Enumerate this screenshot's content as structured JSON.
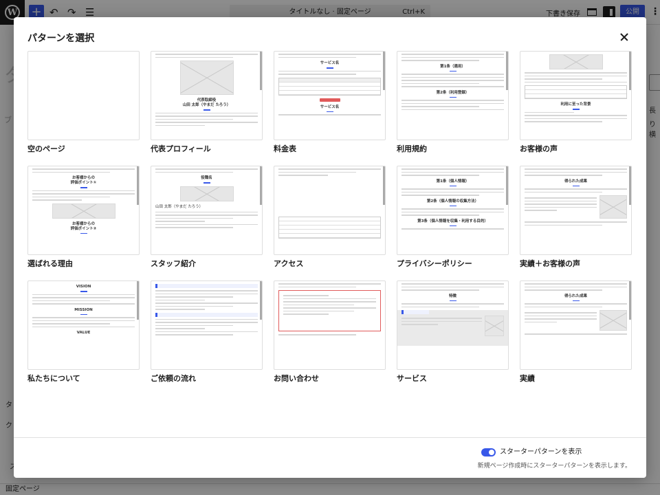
{
  "editor": {
    "document_title": "タイトルなし · 固定ページ",
    "shortcut": "Ctrl+K",
    "save_draft": "下書き保存",
    "publish": "公開",
    "bg_title_fragment": "タ",
    "bg_text_fragment": "ブ",
    "sidebar_fragment_1": "長",
    "sidebar_fragment_2": "り横",
    "left_fragment_1": "タ",
    "left_fragment_2": "ク",
    "left_fragment_3": "ス",
    "breadcrumb": "固定ページ"
  },
  "modal": {
    "title": "パターンを選択",
    "patterns": [
      {
        "label": "空のページ",
        "kind": "blank"
      },
      {
        "label": "代表プロフィール",
        "kind": "profile",
        "heading": "代表取締役\n山田 太郎（やまだ たろう）"
      },
      {
        "label": "料金表",
        "kind": "pricing",
        "heading": "サービス名",
        "heading2": "サービス名"
      },
      {
        "label": "利用規約",
        "kind": "terms",
        "heading": "第1条（適用）",
        "heading2": "第2条（利用登録）"
      },
      {
        "label": "お客様の声",
        "kind": "voice",
        "heading": "利用に至った背景"
      },
      {
        "label": "選ばれる理由",
        "kind": "reasons",
        "heading": "お客様からの\n評価ポイント①",
        "heading2": "お客様からの\n評価ポイント②"
      },
      {
        "label": "スタッフ紹介",
        "kind": "staff",
        "heading": "役職名",
        "subtext": "山田 太郎（やまだ たろう）"
      },
      {
        "label": "アクセス",
        "kind": "access"
      },
      {
        "label": "プライバシーポリシー",
        "kind": "privacy",
        "heading": "第1条（個人情報）",
        "heading2": "第2条（個人情報の収集方法）",
        "heading3": "第3条（個人情報を収集・利用する目的）"
      },
      {
        "label": "実績＋お客様の声",
        "kind": "results_voice",
        "heading": "得られた成果"
      },
      {
        "label": "私たちについて",
        "kind": "about",
        "heading": "VISION",
        "heading2": "MISSION",
        "heading3": "VALUE"
      },
      {
        "label": "ご依頼の流れ",
        "kind": "flow"
      },
      {
        "label": "お問い合わせ",
        "kind": "contact"
      },
      {
        "label": "サービス",
        "kind": "service",
        "heading": "特徴"
      },
      {
        "label": "実績",
        "kind": "results",
        "heading": "得られた成果"
      }
    ]
  },
  "footer": {
    "toggle_label": "スターターパターンを表示",
    "toggle_help": "新規ページ作成時にスターターパターンを表示します。",
    "toggle_on": true
  },
  "colors": {
    "accent": "#3858e9",
    "red": "#e05a5a"
  }
}
